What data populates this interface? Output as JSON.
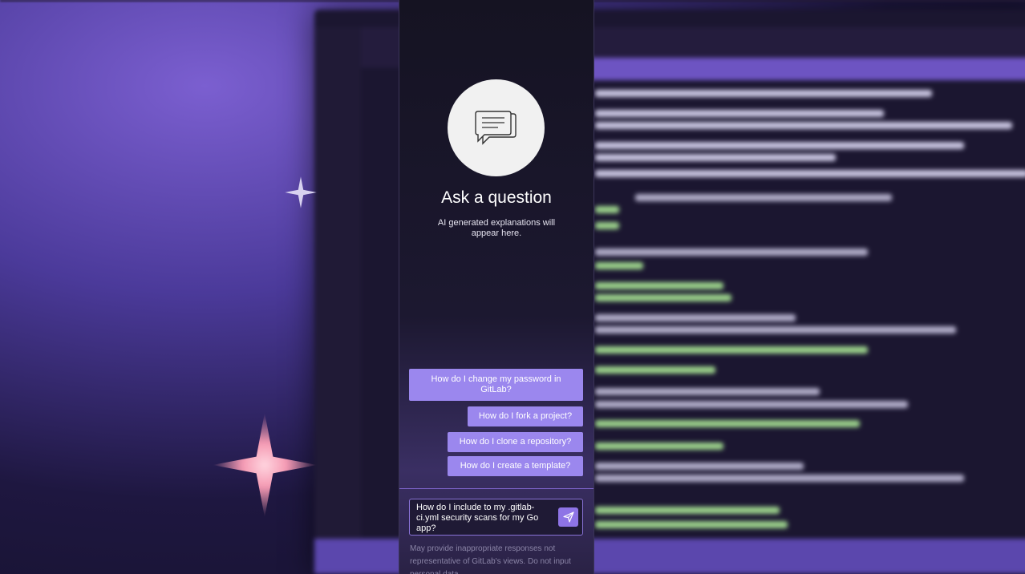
{
  "background": {
    "description_icons": [
      "sparkle-icon",
      "sparkle-icon"
    ]
  },
  "chat": {
    "hero_icon": "chat-bubbles-icon",
    "title": "Ask a question",
    "subtitle": "AI generated explanations will appear here.",
    "suggestions": [
      "How do I change my password in GitLab?",
      "How do I fork a project?",
      "How do I clone a repository?",
      "How do I create a template?"
    ],
    "input_value": "How do I include to my .gitlab-ci.yml security scans for my Go app?",
    "send_icon": "send-icon",
    "disclaimer": "May provide inappropriate responses not representative of GitLab's views. Do not input personal data."
  },
  "colors": {
    "accent": "#9b87ee",
    "send": "#8e74e6",
    "panel_bg": "#1c1830"
  }
}
